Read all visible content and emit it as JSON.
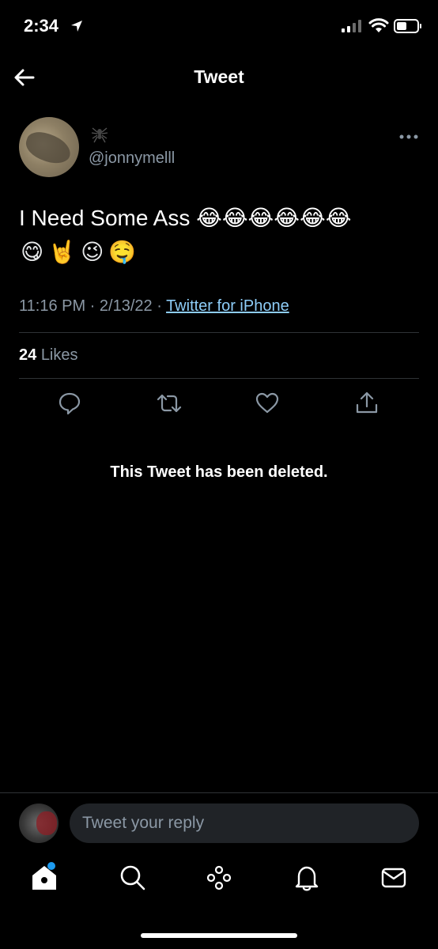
{
  "status_bar": {
    "time": "2:34"
  },
  "header": {
    "title": "Tweet"
  },
  "tweet": {
    "handle": "@jonnymelll",
    "text": "I Need Some Ass 😂😂😂😂😂😂",
    "emojis_line2": [
      "😋",
      "🤘",
      "😉",
      "🤤"
    ],
    "time": "11:16 PM",
    "date": "2/13/22",
    "source": "Twitter for iPhone",
    "likes_count": "24",
    "likes_label": "Likes"
  },
  "deleted_message": "This Tweet has been deleted.",
  "reply": {
    "placeholder": "Tweet your reply"
  },
  "colors": {
    "background": "#000000",
    "accent": "#1d9bf0",
    "secondary_text": "#8b98a5",
    "link": "#8ecdf8"
  },
  "icons": [
    "back-arrow-icon",
    "spider-icon",
    "more-icon",
    "reply-icon",
    "retweet-icon",
    "like-icon",
    "share-icon",
    "home-icon",
    "search-icon",
    "spaces-icon",
    "notifications-icon",
    "messages-icon"
  ]
}
